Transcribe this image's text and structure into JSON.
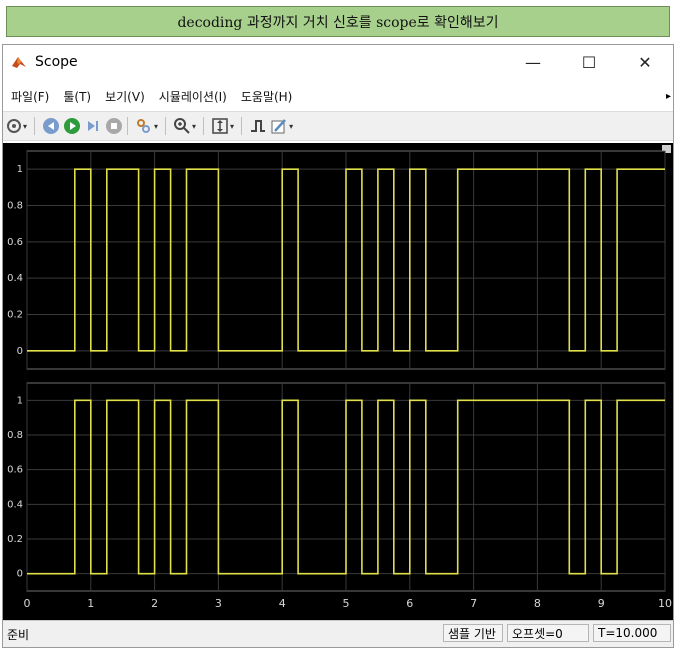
{
  "banner": {
    "text": "decoding 과정까지 거치 신호를 scope로 확인해보기"
  },
  "window": {
    "title": "Scope",
    "controls": {
      "minimize": "—",
      "maximize": "☐",
      "close": "✕"
    }
  },
  "menu": [
    "파일(F)",
    "툴(T)",
    "보기(V)",
    "시뮬레이션(I)",
    "도움말(H)"
  ],
  "toolbar": {
    "icons": [
      "settings-icon",
      "step-back-icon",
      "run-icon",
      "step-forward-icon",
      "stop-icon",
      "highlight-icon",
      "zoom-icon",
      "scale-axes-icon",
      "triggers-icon",
      "style-icon"
    ]
  },
  "colors": {
    "signal": "#e1e04a",
    "axes_bg": "#000000",
    "grid": "#3a3a3a",
    "tick_text": "#d8d8d8"
  },
  "chart_data": [
    {
      "type": "line",
      "step": true,
      "xlim": [
        0,
        10
      ],
      "ylim": [
        -0.1,
        1.1
      ],
      "yticks": [
        0,
        0.2,
        0.4,
        0.6,
        0.8,
        1
      ],
      "ytick_labels": [
        "0",
        "0.2",
        "0.4",
        "0.6",
        "0.8",
        "1"
      ],
      "x": [
        0,
        0.75,
        0.75,
        1.0,
        1.0,
        1.25,
        1.25,
        1.75,
        1.75,
        2.0,
        2.0,
        2.25,
        2.25,
        2.5,
        2.5,
        3.0,
        3.0,
        4.0,
        4.0,
        4.25,
        4.25,
        5.0,
        5.0,
        5.25,
        5.25,
        5.5,
        5.5,
        5.75,
        5.75,
        6.0,
        6.0,
        6.25,
        6.25,
        6.75,
        6.75,
        8.5,
        8.5,
        8.75,
        8.75,
        9.0,
        9.0,
        9.25,
        9.25,
        10.0
      ],
      "y": [
        0,
        0,
        1,
        1,
        0,
        0,
        1,
        1,
        0,
        0,
        1,
        1,
        0,
        0,
        1,
        1,
        0,
        0,
        1,
        1,
        0,
        0,
        1,
        1,
        0,
        0,
        1,
        1,
        0,
        0,
        1,
        1,
        0,
        0,
        1,
        1,
        0,
        0,
        1,
        1,
        0,
        0,
        1,
        1
      ]
    },
    {
      "type": "line",
      "step": true,
      "xlim": [
        0,
        10
      ],
      "ylim": [
        -0.1,
        1.1
      ],
      "yticks": [
        0,
        0.2,
        0.4,
        0.6,
        0.8,
        1
      ],
      "ytick_labels": [
        "0",
        "0.2",
        "0.4",
        "0.6",
        "0.8",
        "1"
      ],
      "xticks": [
        0,
        1,
        2,
        3,
        4,
        5,
        6,
        7,
        8,
        9,
        10
      ],
      "xtick_labels": [
        "0",
        "1",
        "2",
        "3",
        "4",
        "5",
        "6",
        "7",
        "8",
        "9",
        "10"
      ],
      "x": [
        0,
        0.75,
        0.75,
        1.0,
        1.0,
        1.25,
        1.25,
        1.75,
        1.75,
        2.0,
        2.0,
        2.25,
        2.25,
        2.5,
        2.5,
        3.0,
        3.0,
        4.0,
        4.0,
        4.25,
        4.25,
        5.0,
        5.0,
        5.25,
        5.25,
        5.5,
        5.5,
        5.75,
        5.75,
        6.0,
        6.0,
        6.25,
        6.25,
        6.75,
        6.75,
        8.5,
        8.5,
        8.75,
        8.75,
        9.0,
        9.0,
        9.25,
        9.25,
        10.0
      ],
      "y": [
        0,
        0,
        1,
        1,
        0,
        0,
        1,
        1,
        0,
        0,
        1,
        1,
        0,
        0,
        1,
        1,
        0,
        0,
        1,
        1,
        0,
        0,
        1,
        1,
        0,
        0,
        1,
        1,
        0,
        0,
        1,
        1,
        0,
        0,
        1,
        1,
        0,
        0,
        1,
        1,
        0,
        0,
        1,
        1
      ]
    }
  ],
  "status": {
    "ready": "준비",
    "sample_based": "샘플 기반",
    "offset": "오프셋=0",
    "time": "T=10.000"
  }
}
